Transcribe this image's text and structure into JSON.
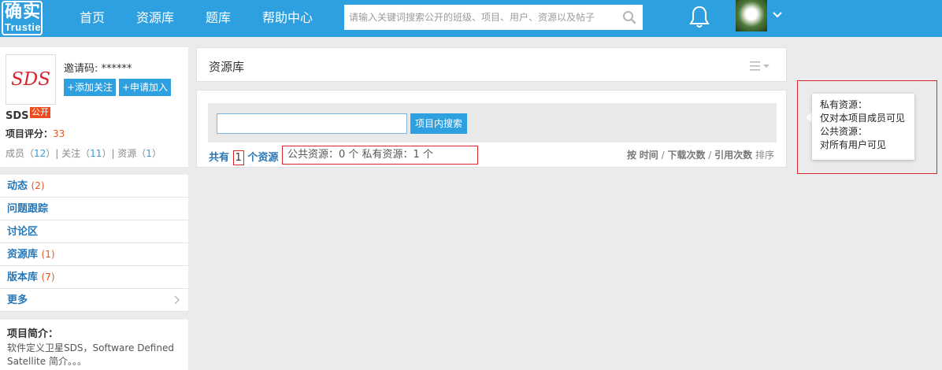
{
  "header": {
    "logo_top": "确实",
    "logo_bottom": "Trustie",
    "nav": [
      "首页",
      "资源库",
      "题库",
      "帮助中心"
    ],
    "search_placeholder": "请输入关键词搜索公开的班级、项目、用户、资源以及帖子"
  },
  "project": {
    "logo_text": "SDS",
    "invite": "邀请码: ******",
    "follow_button": "+添加关注",
    "join_button": "+申请加入",
    "name": "SDS",
    "public_badge": "公开",
    "score_label": "项目评分：",
    "score_value": "33",
    "members_label": "成员（",
    "members_count": "12",
    "follows_label": "）| 关注（",
    "follows_count": "11",
    "resources_label": "）| 资源（",
    "resources_count": "1",
    "close": "）"
  },
  "menu": [
    {
      "label": "动态",
      "count": "(2)"
    },
    {
      "label": "问题跟踪",
      "count": ""
    },
    {
      "label": "讨论区",
      "count": ""
    },
    {
      "label": "资源库",
      "count": "(1)"
    },
    {
      "label": "版本库",
      "count": "(7)"
    },
    {
      "label": "更多",
      "count": ""
    }
  ],
  "intro": {
    "heading": "项目简介：",
    "text": "软件定义卫星SDS，Software Defined Satellite 简介。。。"
  },
  "main": {
    "title": "资源库",
    "search_button": "项目内搜索",
    "total_prefix": "共有 ",
    "total_count": "1",
    "total_suffix": " 个资源",
    "detail": "公共资源：0 个   私有资源：1 个",
    "sort_by": "按",
    "sort_time": "时间",
    "sort_sep1": " / ",
    "sort_downloads": "下载次数",
    "sort_sep2": " / ",
    "sort_refs": "引用次数",
    "sort_suffix": " 排序"
  },
  "tooltip": {
    "private_label": "私有资源：",
    "private_desc": "仅对本项目成员可见",
    "public_label": "公共资源：",
    "public_desc": "对所有用户可见"
  }
}
